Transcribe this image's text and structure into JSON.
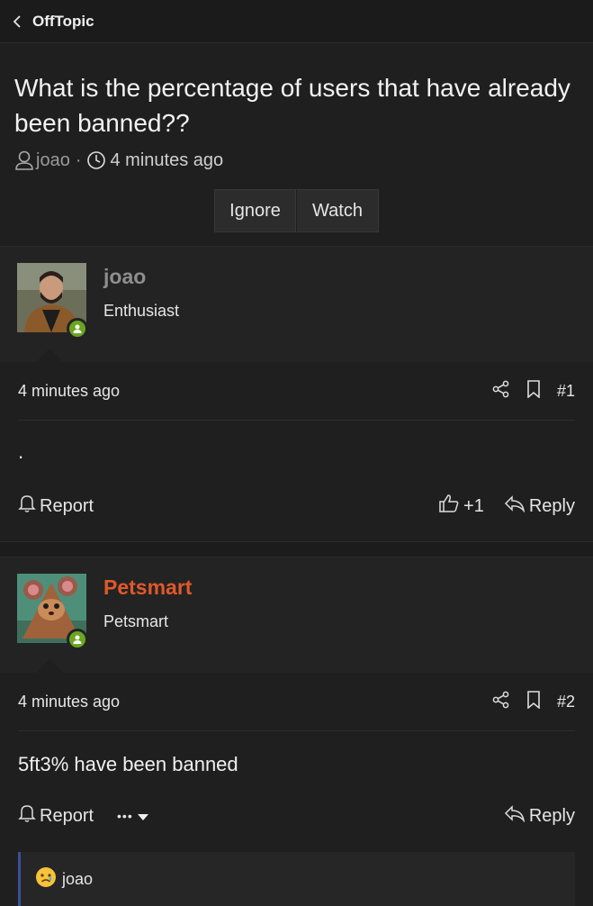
{
  "nav": {
    "back_label": "OffTopic"
  },
  "thread": {
    "title": "What is the percentage of users that have already been banned??",
    "author": "joao",
    "separator": "·",
    "time": "4 minutes ago",
    "ignore_label": "Ignore",
    "watch_label": "Watch"
  },
  "posts": [
    {
      "username": "joao",
      "user_title": "Enthusiast",
      "time": "4 minutes ago",
      "number": "#1",
      "content": ".",
      "report_label": "Report",
      "like_count": "+1",
      "reply_label": "Reply"
    },
    {
      "username": "Petsmart",
      "user_title": "Petsmart",
      "time": "4 minutes ago",
      "number": "#2",
      "content": "5ft3% have been banned",
      "report_label": "Report",
      "more_label": "•••",
      "reply_label": "Reply",
      "reaction_user": "joao"
    }
  ],
  "colors": {
    "online": "#6aa621",
    "username_highlight": "#e0592a",
    "quote_border": "#3e4f9a"
  },
  "icons": [
    "chevron-left-icon",
    "user-icon",
    "clock-icon",
    "share-icon",
    "bookmark-icon",
    "bell-icon",
    "thumbs-up-icon",
    "reply-icon",
    "caret-down-icon",
    "sad-emoji-icon",
    "online-badge-icon"
  ]
}
